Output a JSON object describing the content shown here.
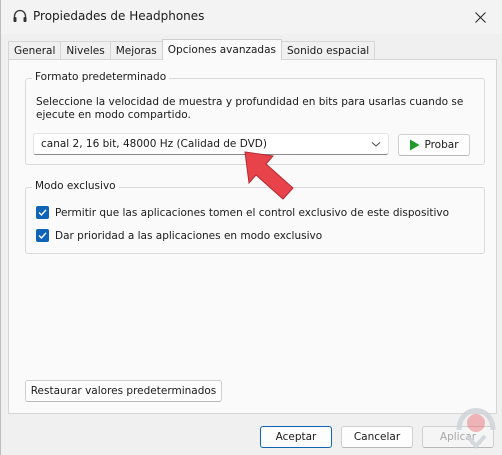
{
  "window": {
    "title": "Propiedades de Headphones",
    "title_icon": "headphones-icon",
    "close_icon": "close-icon"
  },
  "tabs": [
    {
      "label": "General",
      "active": false
    },
    {
      "label": "Niveles",
      "active": false
    },
    {
      "label": "Mejoras",
      "active": false
    },
    {
      "label": "Opciones avanzadas",
      "active": true
    },
    {
      "label": "Sonido espacial",
      "active": false
    }
  ],
  "default_format": {
    "legend": "Formato predeterminado",
    "description": "Seleccione la velocidad de muestra y profundidad en bits para usarlas cuando se ejecute en modo compartido.",
    "selected_value": "canal 2, 16 bit, 48000 Hz (Calidad de DVD)",
    "test_button_label": "Probar"
  },
  "exclusive_mode": {
    "legend": "Modo exclusivo",
    "options": [
      {
        "label": "Permitir que las aplicaciones tomen el control exclusivo de este dispositivo",
        "checked": true
      },
      {
        "label": "Dar prioridad a las aplicaciones en modo exclusivo",
        "checked": true
      }
    ]
  },
  "restore_button_label": "Restaurar valores predeterminados",
  "footer": {
    "ok_label": "Aceptar",
    "cancel_label": "Cancelar",
    "apply_label": "Aplicar"
  },
  "colors": {
    "accent": "#0f64b8",
    "annotation_arrow": "#e8424a",
    "play_icon": "#1f9a2a"
  }
}
